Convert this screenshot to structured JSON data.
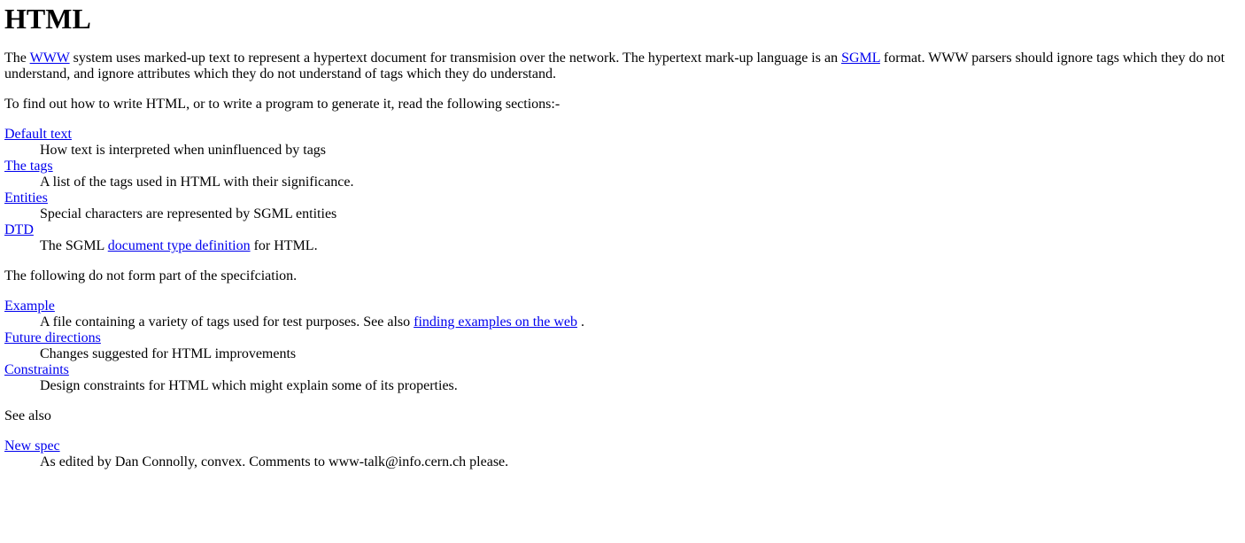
{
  "title": "HTML",
  "intro": {
    "t1": "The ",
    "link_www": "WWW",
    "t2": " system uses marked-up text to represent a hypertext document for transmision over the network. The hypertext mark-up language is an ",
    "link_sgml": "SGML",
    "t3": " format. WWW parsers should ignore tags which they do not understand, and ignore attributes which they do not understand of tags which they do understand."
  },
  "find_out": "To find out how to write HTML, or to write a program to generate it, read the following sections:-",
  "sections": [
    {
      "term": "Default text",
      "desc": "How text is interpreted when uninfluenced by tags"
    },
    {
      "term": "The tags",
      "desc": "A list of the tags used in HTML with their significance."
    },
    {
      "term": "Entities",
      "desc": "Special characters are represented by SGML entities"
    },
    {
      "term": "DTD",
      "desc_pre": "The SGML ",
      "desc_link": "document type definition",
      "desc_post": " for HTML."
    }
  ],
  "not_spec": "The following do not form part of the specifciation.",
  "extras": [
    {
      "term": "Example",
      "desc_pre": "A file containing a variety of tags used for test purposes. See also ",
      "desc_link": "finding examples on the web",
      "desc_post": " ."
    },
    {
      "term": "Future directions",
      "desc": "Changes suggested for HTML improvements"
    },
    {
      "term": "Constraints",
      "desc": "Design constraints for HTML which might explain some of its properties."
    }
  ],
  "see_also": "See also",
  "see_also_items": [
    {
      "term": "New spec",
      "desc": "As edited by Dan Connolly, convex. Comments to www-talk@info.cern.ch please."
    }
  ],
  "colors": {
    "link": "#0000ee",
    "text": "#000000",
    "background": "#ffffff"
  }
}
